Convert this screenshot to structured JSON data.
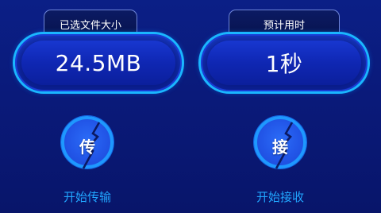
{
  "stats": {
    "selected_size": {
      "label": "已选文件大小",
      "value": "24.5MB"
    },
    "estimated_time": {
      "label": "预计用时",
      "value": "1秒"
    }
  },
  "actions": {
    "send": {
      "icon_char": "传",
      "label": "开始传输"
    },
    "receive": {
      "icon_char": "接",
      "label": "开始接收"
    }
  },
  "colors": {
    "background": "#0a1a7a",
    "pill_border": "#1ab6ff",
    "round_fill": "#2256e8",
    "caption": "#21a6ff",
    "bolt": "#0b1a63"
  }
}
